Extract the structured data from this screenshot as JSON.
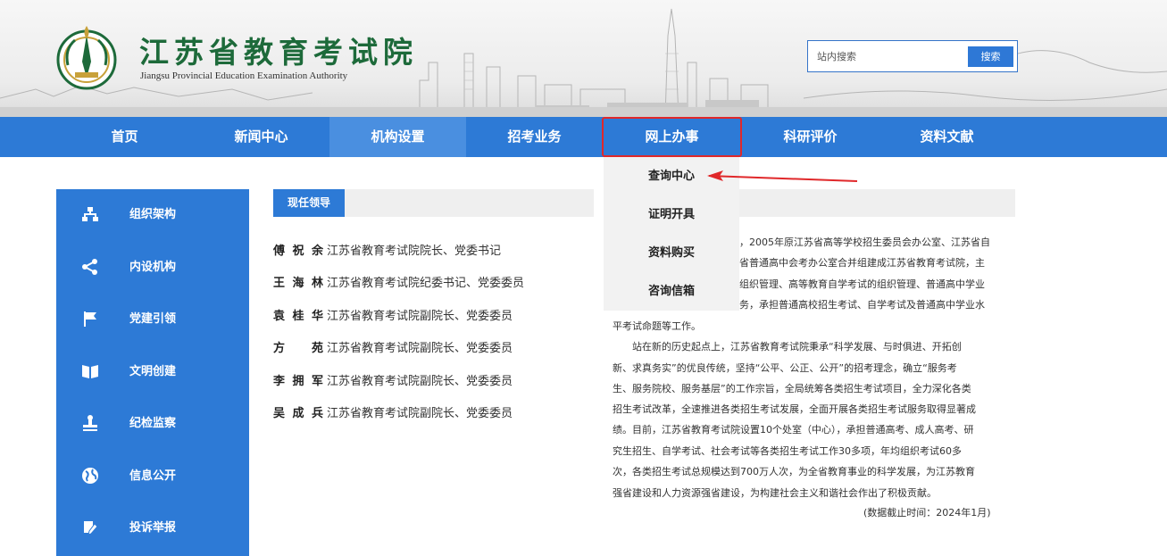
{
  "header": {
    "logo_cn": "江苏省教育考试院",
    "logo_en": "Jiangsu Provincial Education Examination Authority",
    "search_placeholder": "站内搜索",
    "search_button": "搜索"
  },
  "nav": {
    "items": [
      {
        "label": "首页"
      },
      {
        "label": "新闻中心"
      },
      {
        "label": "机构设置"
      },
      {
        "label": "招考业务"
      },
      {
        "label": "网上办事"
      },
      {
        "label": "科研评价"
      },
      {
        "label": "资料文献"
      }
    ],
    "active": "机构设置",
    "highlighted": "网上办事"
  },
  "dropdown": {
    "items": [
      "查询中心",
      "证明开具",
      "资料购买",
      "咨询信箱"
    ]
  },
  "sidebar": {
    "items": [
      {
        "label": "组织架构",
        "icon": "org-chart-icon"
      },
      {
        "label": "内设机构",
        "icon": "share-nodes-icon"
      },
      {
        "label": "党建引领",
        "icon": "flag-icon"
      },
      {
        "label": "文明创建",
        "icon": "book-open-icon"
      },
      {
        "label": "纪检监察",
        "icon": "stamp-icon"
      },
      {
        "label": "信息公开",
        "icon": "globe-icon"
      },
      {
        "label": "投诉举报",
        "icon": "edit-icon"
      }
    ]
  },
  "leaders": {
    "section_title": "现任领导",
    "items": [
      {
        "name": "傅祝余",
        "title": "江苏省教育考试院院长、党委书记"
      },
      {
        "name": "王海林",
        "title": "江苏省教育考试院纪委书记、党委委员"
      },
      {
        "name": "袁桂华",
        "title": "江苏省教育考试院副院长、党委委员"
      },
      {
        "name": "方苑",
        "title": "江苏省教育考试院副院长、党委委员"
      },
      {
        "name": "李拥军",
        "title": "江苏省教育考试院副院长、党委委员"
      },
      {
        "name": "吴成兵",
        "title": "江苏省教育考试院副院长、党委委员"
      }
    ]
  },
  "intro": {
    "lines": [
      "，2005年原江苏省高等学校招生委员会办公室、江苏省自",
      "省普通高中会考办公室合并组建成江苏省教育考试院，主",
      "组织管理、高等教育自学考试的组织管理、普通高中学业",
      "务，承担普通高校招生考试、自学考试及普通高中学业水",
      "平考试命题等工作。",
      "站在新的历史起点上，江苏省教育考试院秉承“科学发展、与时俱进、开拓创",
      "新、求真务实”的优良传统，坚持“公平、公正、公开”的招考理念，确立“服务考",
      "生、服务院校、服务基层”的工作宗旨，全局统筹各类招生考试项目，全力深化各类",
      "招生考试改革，全速推进各类招生考试发展，全面开展各类招生考试服务取得显著成",
      "绩。目前，江苏省教育考试院设置10个处室（中心），承担普通高考、成人高考、研",
      "究生招生、自学考试、社会考试等各类招生考试工作30多项，年均组织考试60多",
      "次，各类招生考试总规模达到700万人次，为全省教育事业的科学发展，为江苏教育",
      "强省建设和人力资源强省建设，为构建社会主义和谐社会作出了积极贡献。"
    ],
    "date_note": "(数据截止时间：2024年1月)"
  },
  "colors": {
    "primary": "#2d7ad6",
    "highlight_border": "#e0282a",
    "logo_green": "#1d6a3a"
  }
}
